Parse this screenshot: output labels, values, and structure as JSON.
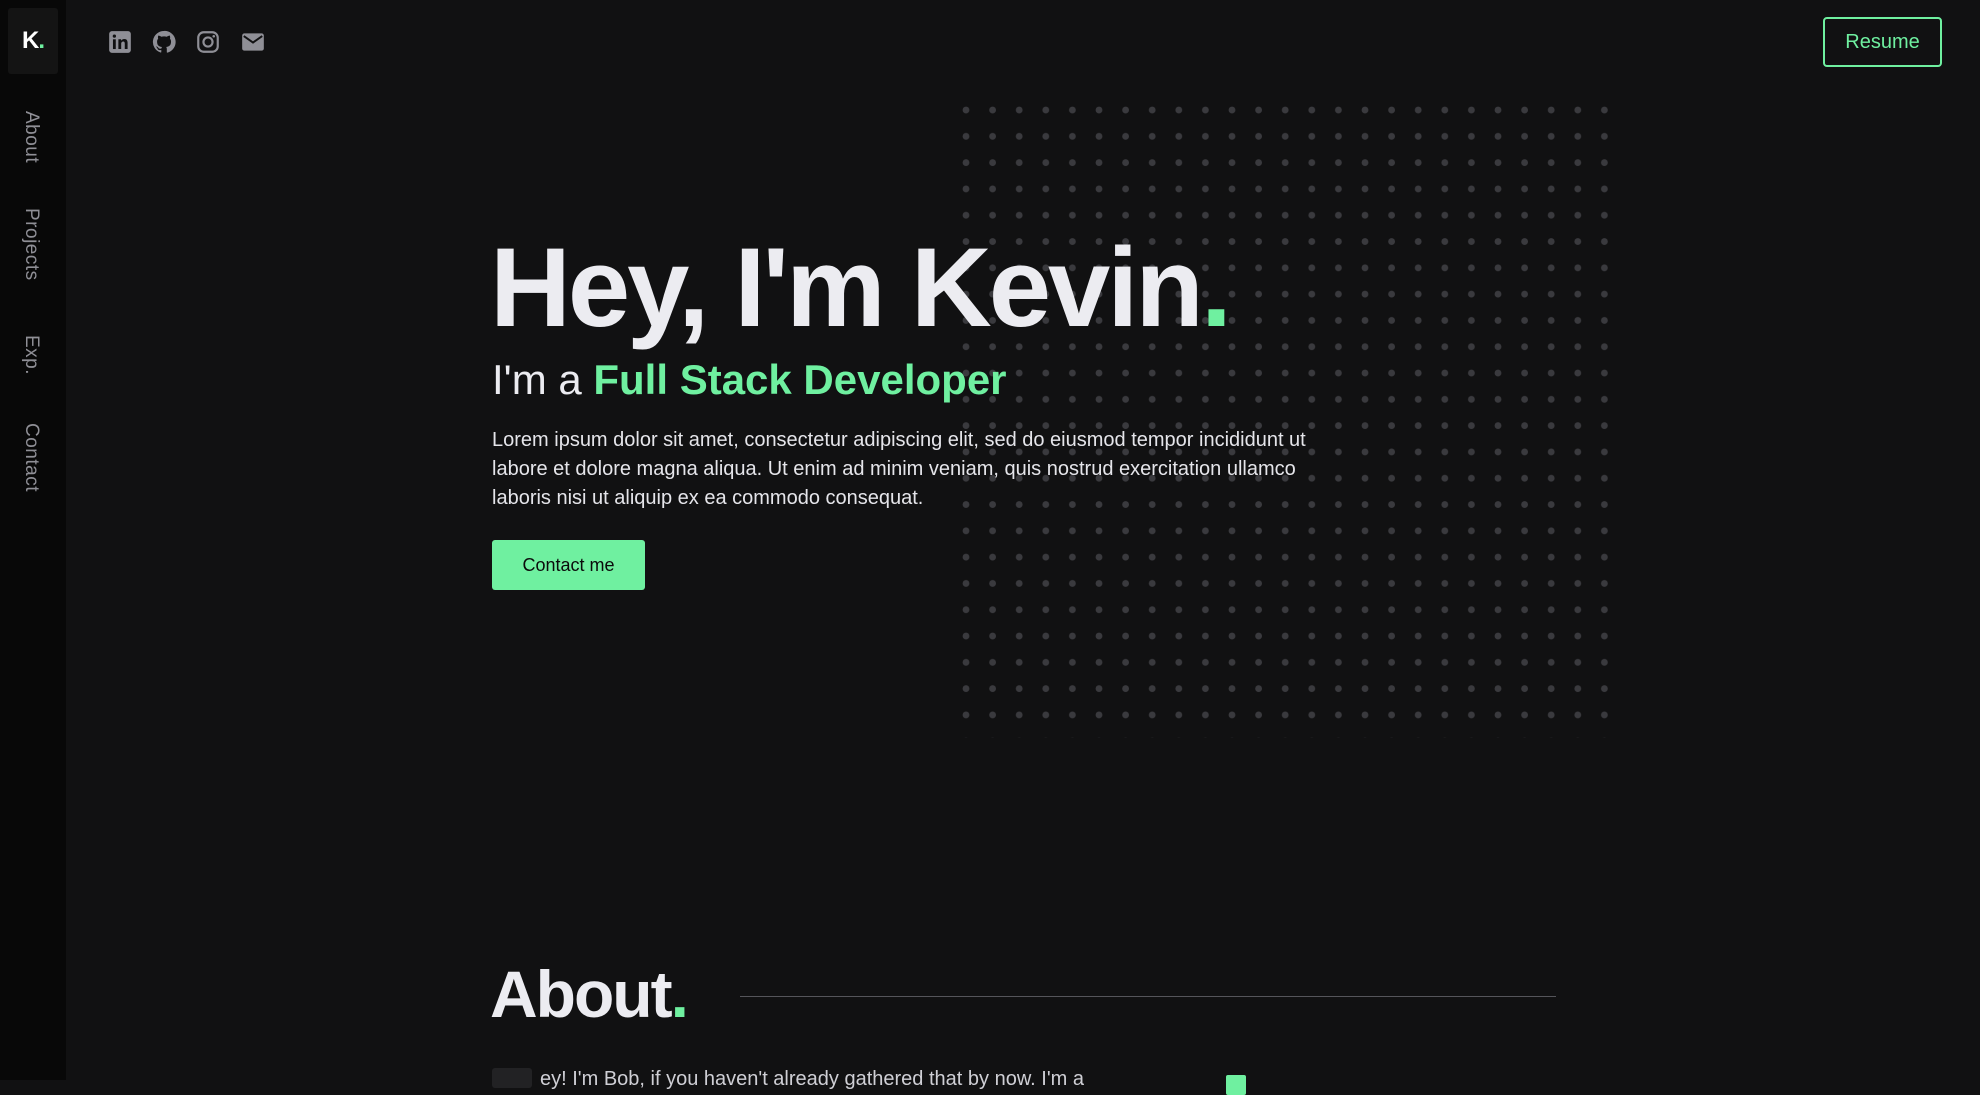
{
  "logo": {
    "letter": "K",
    "dot": "."
  },
  "nav": [
    "About",
    "Projects",
    "Exp.",
    "Contact"
  ],
  "social": [
    "linkedin-icon",
    "github-icon",
    "instagram-icon",
    "mail-icon"
  ],
  "resume": "Resume",
  "hero": {
    "title": "Hey, I'm Kevin",
    "title_dot": ".",
    "subtitle_prefix": "I'm a ",
    "subtitle_role": "Full Stack Developer",
    "description": "Lorem ipsum dolor sit amet, consectetur adipiscing elit, sed do eiusmod tempor incididunt ut labore et dolore magna aliqua. Ut enim ad minim veniam, quis nostrud exercitation ullamco laboris nisi ut aliquip ex ea commodo consequat.",
    "cta": "Contact me"
  },
  "about": {
    "title": "About",
    "title_dot": ".",
    "preview_text": "ey! I'm Bob, if you haven't already gathered that by now. I'm a"
  },
  "colors": {
    "accent": "#6ff0a0",
    "background": "#111112",
    "sidebar": "#080808",
    "text": "#ececf1"
  }
}
